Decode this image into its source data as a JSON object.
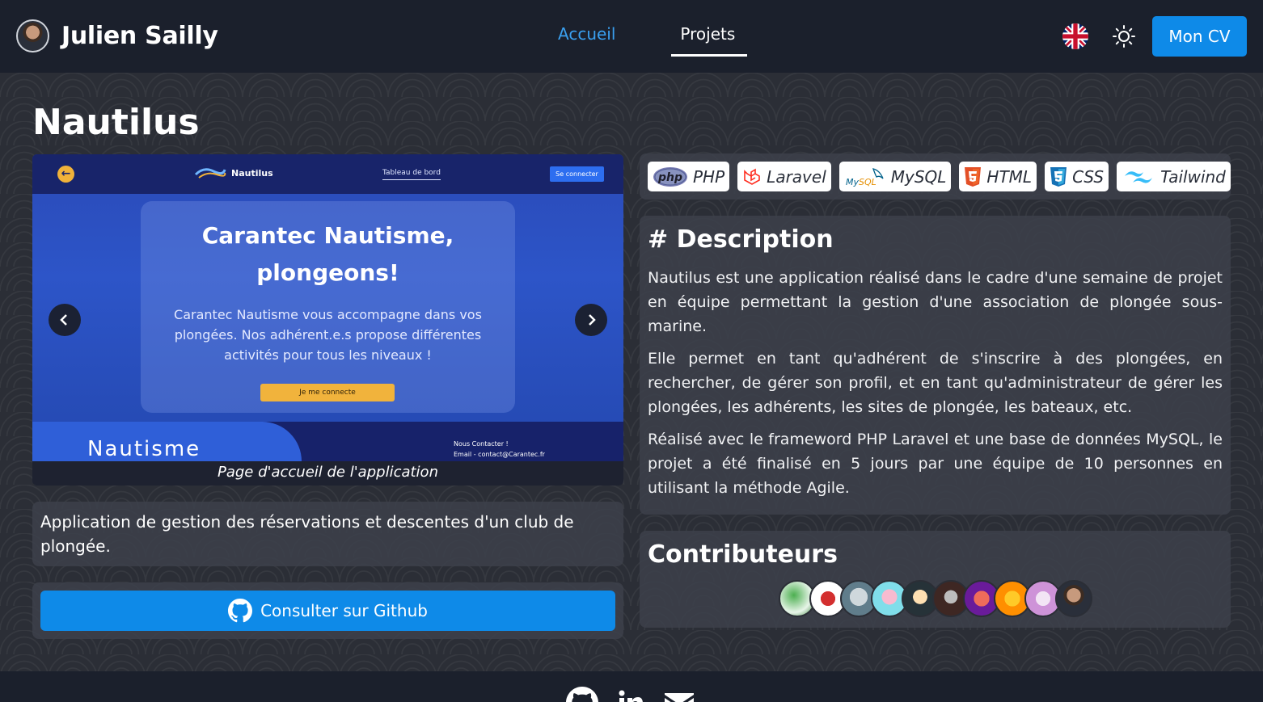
{
  "header": {
    "brand_name": "Julien Sailly",
    "nav": [
      {
        "label": "Accueil"
      },
      {
        "label": "Projets"
      }
    ],
    "cv_button": "Mon CV",
    "language_icon": "uk-flag-icon",
    "theme_icon": "sun-icon"
  },
  "project": {
    "title": "Nautilus",
    "carousel": {
      "caption": "Page d'accueil de l'application",
      "screenshot": {
        "logo_text": "Nautilus",
        "nav_link": "Tableau de bord",
        "connect_button": "Se connecter",
        "card_title": "Carantec Nautisme, plongeons!",
        "card_text": "Carantec Nautisme vous accompagne dans vos plongées. Nos adhérent.e.s propose différentes activités pour tous les niveaux !",
        "card_button": "Je me connecte",
        "footer_logo": "Nautisme",
        "footer_contact_line1": "Nous Contacter !",
        "footer_contact_line2": "Email - contact@Carantec.fr"
      }
    },
    "tagline": "Application de gestion des réservations et descentes d'un club de plongée.",
    "github_button": "Consulter sur Github",
    "technologies": [
      {
        "label": "PHP"
      },
      {
        "label": "Laravel"
      },
      {
        "label": "MySQL"
      },
      {
        "label": "HTML"
      },
      {
        "label": "CSS"
      },
      {
        "label": "Tailwind"
      }
    ],
    "description": {
      "title": "# Description",
      "paragraphs": [
        "Nautilus est une application réalisé dans le cadre d'une semaine de projet en équipe permettant la gestion d'une association de plongée sous-marine.",
        "Elle permet en tant qu'adhérent de s'inscrire à des plongées, en rechercher, de gérer son profil, et en tant qu'administrateur de gérer les plongées, les adhérents, les sites de plongée, les bateaux, etc.",
        "Réalisé avec le frameword PHP Laravel et une base de données MySQL, le projet a été finalisé en 5 jours par une équipe de 10 personnes en utilisant la méthode Agile."
      ]
    },
    "contributors": {
      "title": "Contributeurs",
      "count": 10
    }
  },
  "colors": {
    "accent": "#0e8ae8",
    "nav_active": "#3aa0f0",
    "header_bg": "#1b202c",
    "card_bg": "#3c404a"
  }
}
